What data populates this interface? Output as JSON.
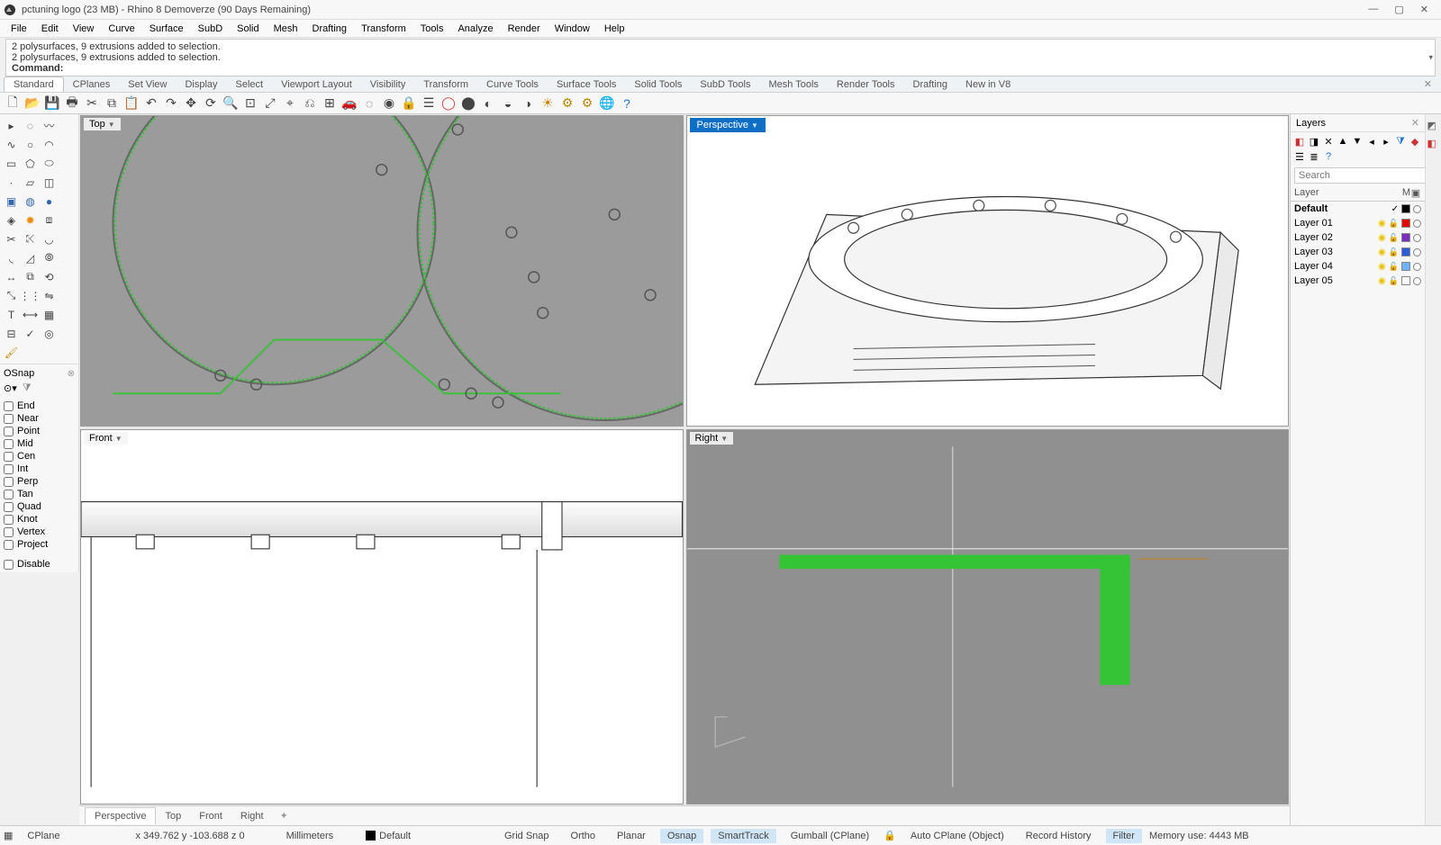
{
  "title": "pctuning logo (23 MB) - Rhino 8 Demoverze (90 Days Remaining)",
  "menu": [
    "File",
    "Edit",
    "View",
    "Curve",
    "Surface",
    "SubD",
    "Solid",
    "Mesh",
    "Drafting",
    "Transform",
    "Tools",
    "Analyze",
    "Render",
    "Window",
    "Help"
  ],
  "cmdlines": [
    "2 polysurfaces, 9 extrusions added to selection.",
    "2 polysurfaces, 9 extrusions added to selection."
  ],
  "cmd_prompt": "Command:",
  "tool_tabs": [
    "Standard",
    "CPlanes",
    "Set View",
    "Display",
    "Select",
    "Viewport Layout",
    "Visibility",
    "Transform",
    "Curve Tools",
    "Surface Tools",
    "Solid Tools",
    "SubD Tools",
    "Mesh Tools",
    "Render Tools",
    "Drafting",
    "New in V8"
  ],
  "viewport_labels": {
    "top": "Top",
    "perspective": "Perspective",
    "front": "Front",
    "right": "Right"
  },
  "osnap": {
    "title": "OSnap",
    "items": [
      "End",
      "Near",
      "Point",
      "Mid",
      "Cen",
      "Int",
      "Perp",
      "Tan",
      "Quad",
      "Knot",
      "Vertex",
      "Project"
    ],
    "disable": "Disable"
  },
  "view_tabs": [
    "Perspective",
    "Top",
    "Front",
    "Right"
  ],
  "status": {
    "cplane": "CPlane",
    "coord": "x 349.762   y -103.688   z 0",
    "units": "Millimeters",
    "layer": "Default",
    "gridsnap": "Grid Snap",
    "ortho": "Ortho",
    "planar": "Planar",
    "osnap": "Osnap",
    "smarttrack": "SmartTrack",
    "gumball": "Gumball (CPlane)",
    "autocplane": "Auto CPlane (Object)",
    "recordhist": "Record History",
    "filter": "Filter",
    "memory": "Memory use: 4443 MB"
  },
  "layers_panel": {
    "title": "Layers",
    "search_placeholder": "Search",
    "col_layer": "Layer",
    "col_m": "M",
    "layers": [
      {
        "name": "Default",
        "current": true,
        "color": "#000000"
      },
      {
        "name": "Layer 01",
        "current": false,
        "color": "#e20000"
      },
      {
        "name": "Layer 02",
        "current": false,
        "color": "#7a2fbf"
      },
      {
        "name": "Layer 03",
        "current": false,
        "color": "#2b5fd9"
      },
      {
        "name": "Layer 04",
        "current": false,
        "color": "#6fb3ff"
      },
      {
        "name": "Layer 05",
        "current": false,
        "color": "#ffffff"
      }
    ]
  }
}
